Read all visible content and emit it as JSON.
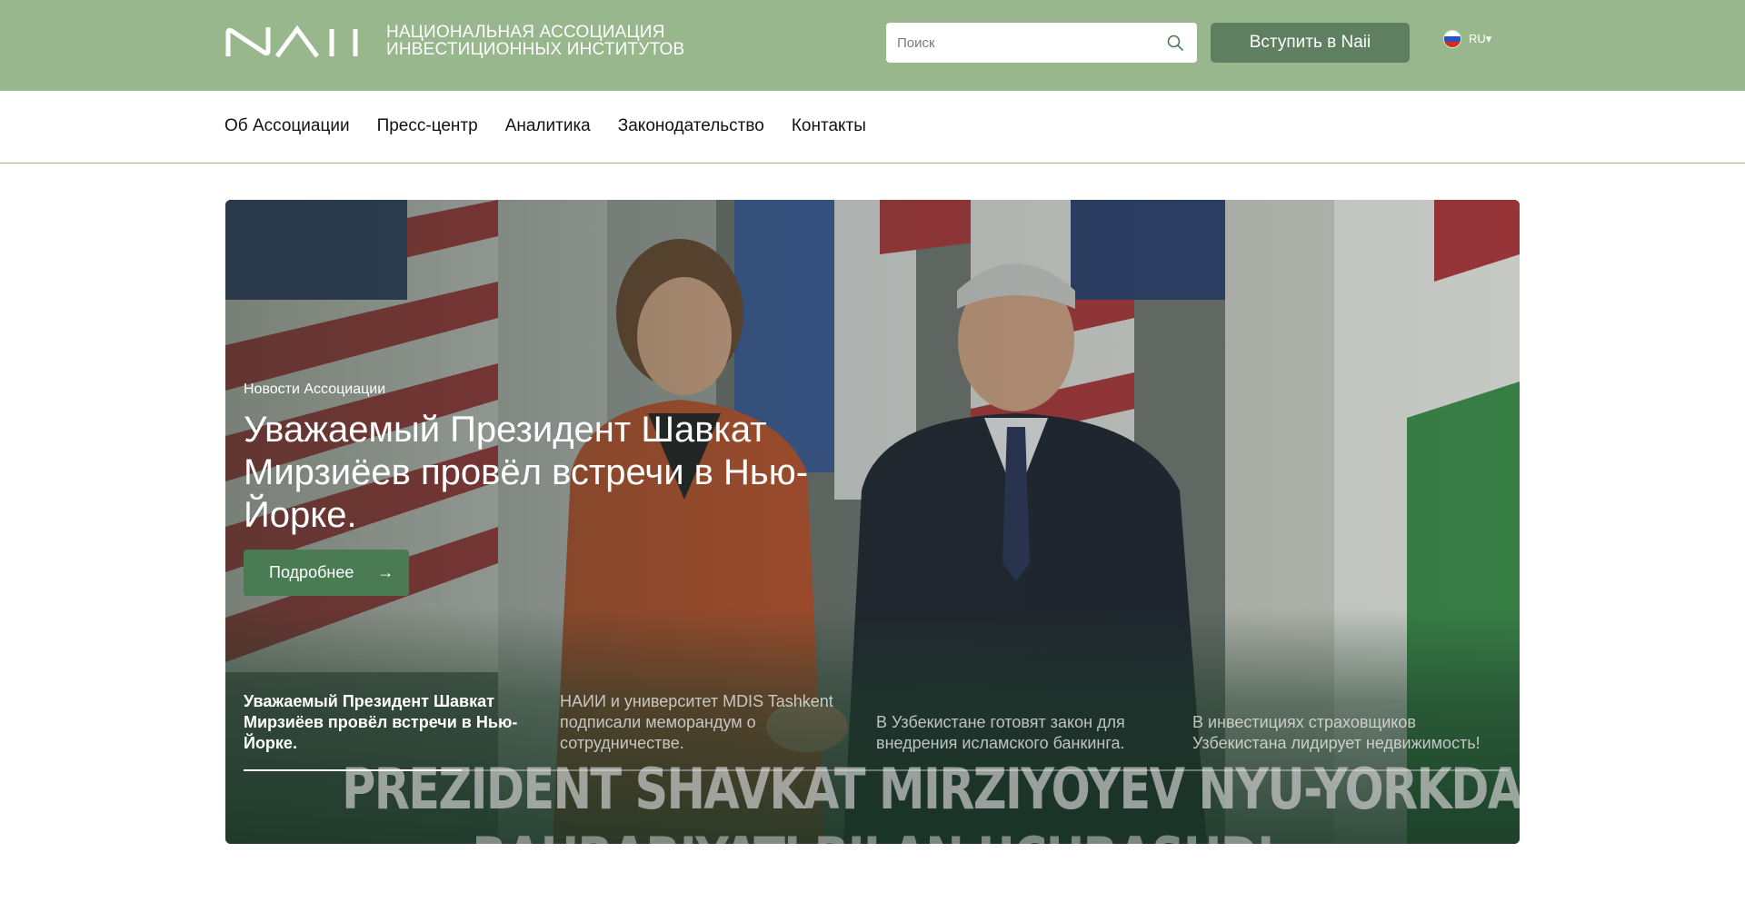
{
  "header": {
    "org_name_line1": "НАЦИОНАЛЬНАЯ АССОЦИАЦИЯ",
    "org_name_line2": "ИНВЕСТИЦИОННЫХ ИНСТИТУТОВ",
    "logo_icon": "naii-logo",
    "search": {
      "placeholder": "Поиск",
      "value": "",
      "icon": "search-icon"
    },
    "join_label": "Вступить в Naii",
    "language": {
      "code": "RU",
      "caret": "▾",
      "flag_icon": "russia-flag-icon"
    },
    "colors": {
      "bar": "#98b78c",
      "join_button": "#5f7f61"
    }
  },
  "nav": {
    "items": [
      {
        "label": "Об Ассоциации"
      },
      {
        "label": "Пресс-центр"
      },
      {
        "label": "Аналитика"
      },
      {
        "label": "Законодательство"
      },
      {
        "label": "Контакты"
      }
    ]
  },
  "hero": {
    "category": "Новости Ассоциации",
    "title": "Уважаемый Президент Шавкат Мирзиёев провёл встречи в Нью-Йорке.",
    "more_label": "Подробнее",
    "more_icon": "arrow-right-icon",
    "image_text_line1": "PREZIDENT SHAVKAT MIRZIYOYEV NYU-YORKDA NASDAQ",
    "image_text_line2": "RAHBARIYATI BILAN UCHRASHDI",
    "slides": [
      {
        "title": "Уважаемый Президент Шавкат Мирзиёев провёл встречи в Нью-Йорке.",
        "active": true
      },
      {
        "title": "НАИИ и университет MDIS Tashkent подписали меморандум о сотрудничестве.",
        "active": false
      },
      {
        "title": "В Узбекистане готовят закон для внедрения исламского банкинга.",
        "active": false
      },
      {
        "title": "В инвестициях страховщиков Узбекистана лидирует недвижимость!",
        "active": false
      }
    ],
    "colors": {
      "more_button": "#4a7b52"
    }
  }
}
